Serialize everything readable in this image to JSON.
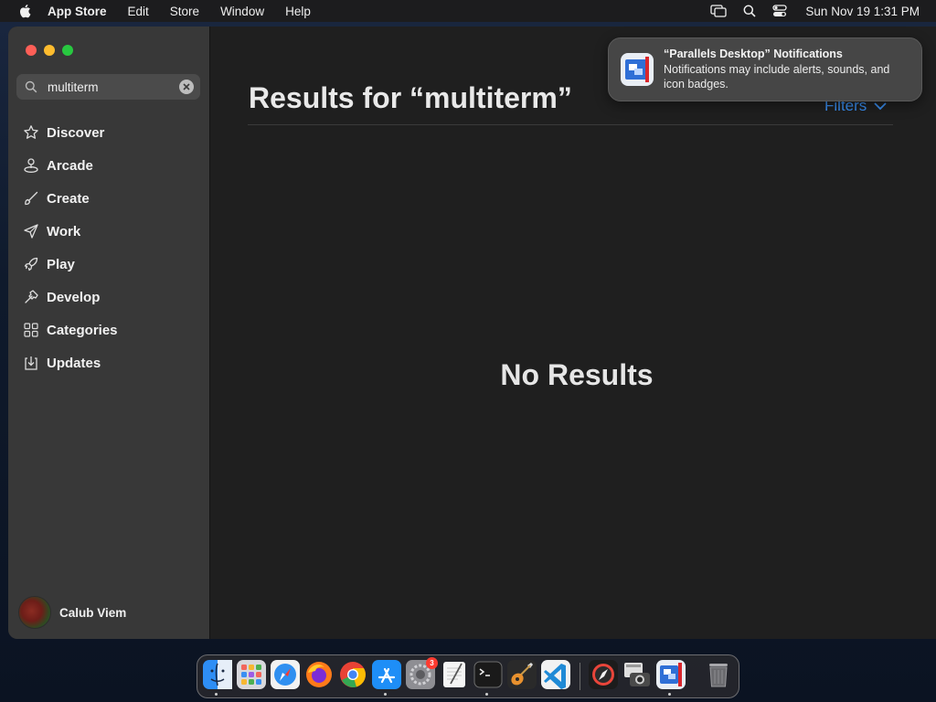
{
  "menubar": {
    "app_name": "App Store",
    "items": [
      "Edit",
      "Store",
      "Window",
      "Help"
    ],
    "clock": "Sun Nov 19  1:31 PM"
  },
  "sidebar": {
    "search": {
      "value": "multiterm",
      "placeholder": "Search"
    },
    "items": [
      {
        "label": "Discover",
        "icon": "star-icon"
      },
      {
        "label": "Arcade",
        "icon": "joystick-icon"
      },
      {
        "label": "Create",
        "icon": "brush-icon"
      },
      {
        "label": "Work",
        "icon": "paper-plane-icon"
      },
      {
        "label": "Play",
        "icon": "rocket-icon"
      },
      {
        "label": "Develop",
        "icon": "hammer-icon"
      },
      {
        "label": "Categories",
        "icon": "grid-icon"
      },
      {
        "label": "Updates",
        "icon": "download-tray-icon"
      }
    ],
    "user_name": "Calub Viem"
  },
  "main": {
    "title": "Results for “multiterm”",
    "filters_label": "Filters",
    "empty_text": "No Results"
  },
  "notification": {
    "title": "“Parallels Desktop” Notifications",
    "body": "Notifications may include alerts, sounds, and icon badges."
  },
  "dock": {
    "apps": [
      "Finder",
      "Launchpad",
      "Safari",
      "Firefox",
      "Chrome",
      "App Store",
      "System Settings",
      "TextEdit",
      "Terminal",
      "GarageBand",
      "Visual Studio Code",
      "Compass",
      "Image Capture",
      "Parallels Desktop",
      "Trash"
    ],
    "settings_badge": "3"
  },
  "colors": {
    "accent": "#3a8ff2",
    "sidebar_bg": "#383838",
    "content_bg": "#1f1f1f"
  }
}
